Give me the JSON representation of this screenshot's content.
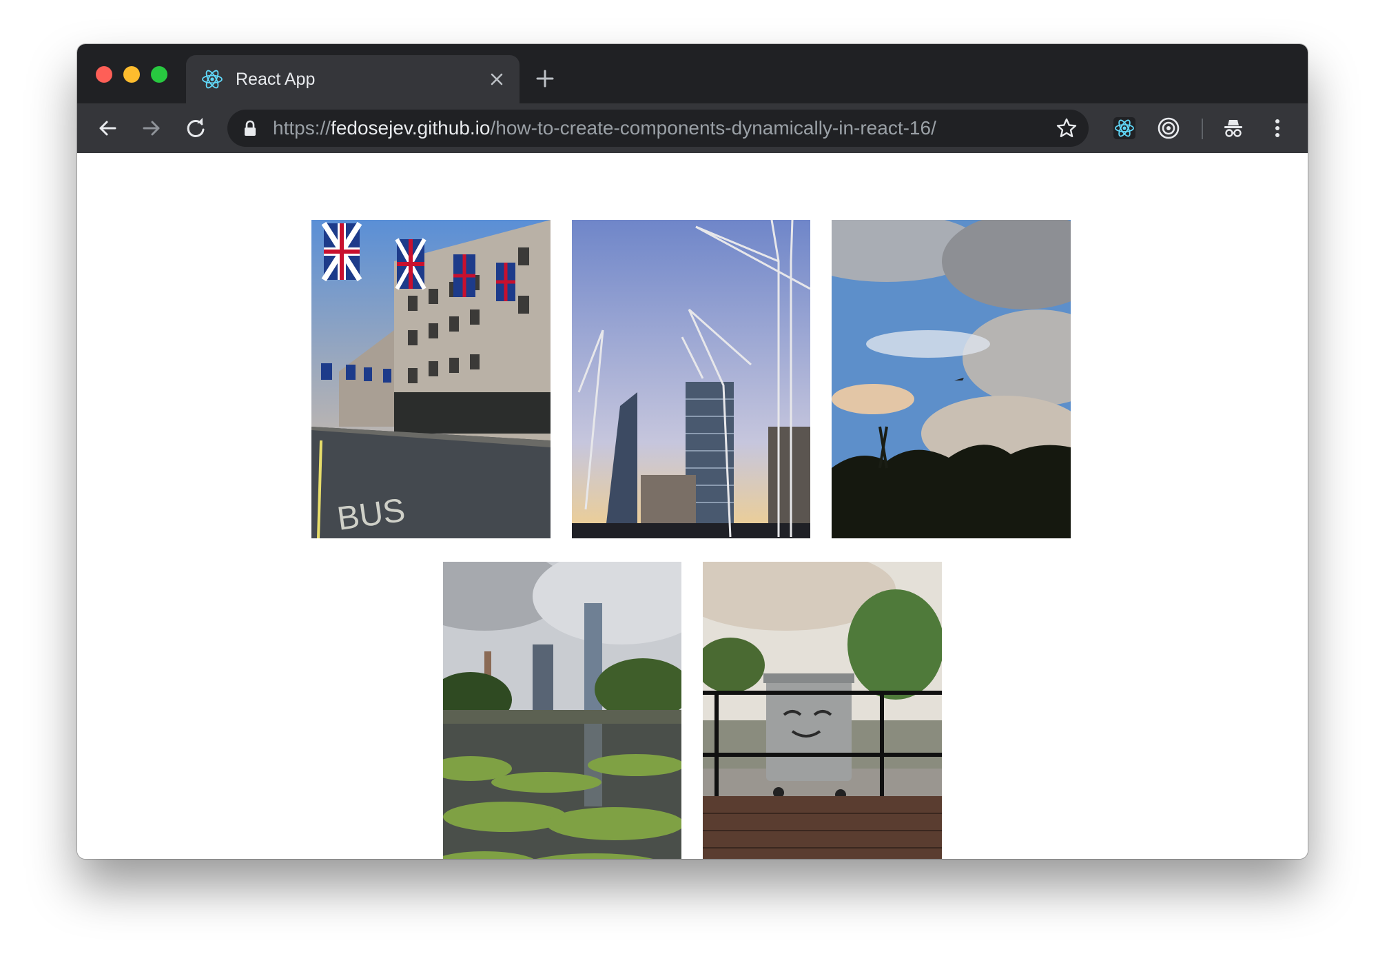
{
  "tab": {
    "title": "React App"
  },
  "address_bar": {
    "scheme": "https://",
    "host": "fedosejev.github.io",
    "path": "/how-to-create-components-dynamically-in-react-16/"
  },
  "icons": {
    "favicon": "react-logo-icon",
    "close": "close-icon",
    "new_tab": "plus-icon",
    "back": "arrow-left-icon",
    "forward": "arrow-right-icon",
    "reload": "reload-icon",
    "lock": "lock-icon",
    "bookmark": "star-icon",
    "react_devtools": "react-devtools-icon",
    "extension": "target-icon",
    "incognito": "incognito-icon",
    "menu": "kebab-menu-icon"
  },
  "colors": {
    "titlebar": "#202124",
    "toolbar": "#35363a",
    "omnibox": "#202124",
    "react_accent": "#61dafb"
  },
  "gallery": {
    "photos": [
      {
        "subject": "oxford-street-union-jack-flags"
      },
      {
        "subject": "construction-cranes-skyscrapers"
      },
      {
        "subject": "cloudy-sky-airplane"
      },
      {
        "subject": "canal-with-algae-and-towers"
      },
      {
        "subject": "wheelie-bin-with-cat-face"
      }
    ]
  }
}
